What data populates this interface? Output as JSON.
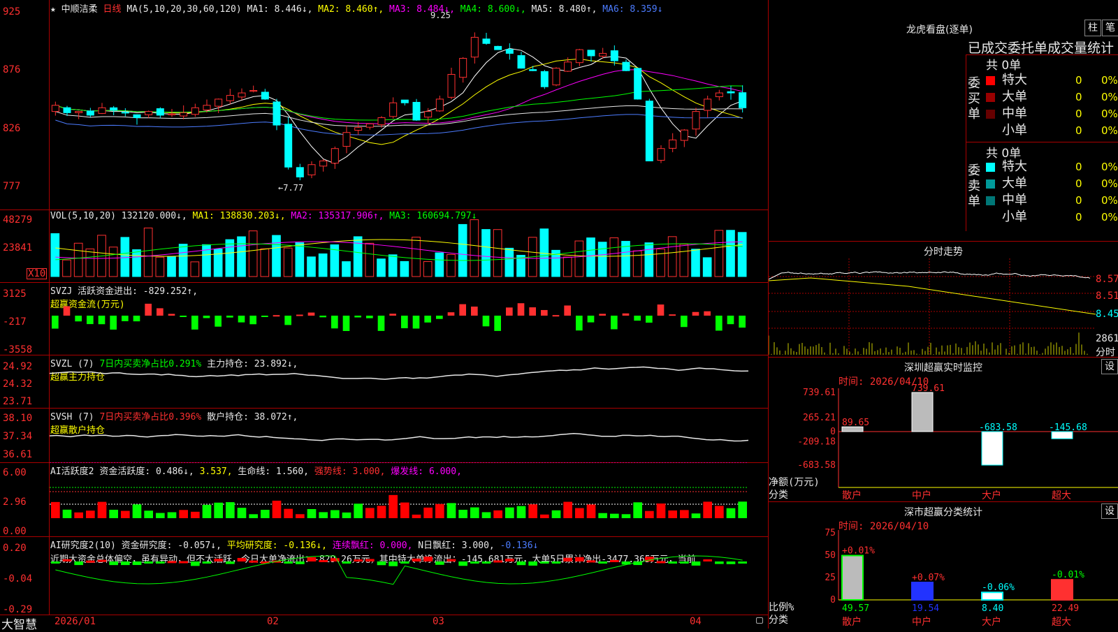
{
  "main": {
    "title_star": "★",
    "stock_name": "中顺洁柔",
    "period": "日线",
    "ma_label": "MA(5,10,20,30,60,120)",
    "ma1": "MA1: 8.446↓,",
    "ma2": "MA2: 8.460↑,",
    "ma3": "MA3: 8.484↓,",
    "ma4": "MA4: 8.600↓,",
    "ma5": "MA5: 8.480↑,",
    "ma6": "MA6: 8.359↓",
    "high_mark": "9.25",
    "low_mark": "←7.77",
    "yticks": [
      "925",
      "876",
      "826",
      "777"
    ]
  },
  "volume": {
    "label": "VOL(5,10,20)",
    "value": "132120.000↓,",
    "ma1": "MA1: 138830.203↓,",
    "ma2": "MA2: 135317.906↑,",
    "ma3": "MA3: 160694.797↓",
    "yticks": [
      "48279",
      "23841"
    ],
    "unit": "X10"
  },
  "svzj": {
    "label": "SVZJ",
    "text": "活跃资金进出: -829.252↑,",
    "sub": "超赢资金流(万元)",
    "yticks": [
      "3125",
      "-217",
      "-3558"
    ]
  },
  "svzl": {
    "label": "SVZL (7)",
    "ratio": "7日内买卖净占比0.291%",
    "hold": "主力持仓: 23.892↓,",
    "sub": "超赢主力持仓",
    "yticks": [
      "24.92",
      "24.32",
      "23.71"
    ]
  },
  "svsh": {
    "label": "SVSH (7)",
    "ratio": "7日内买卖净占比0.396%",
    "hold": "散户持仓: 38.072↑,",
    "sub": "超赢散户持仓",
    "yticks": [
      "38.10",
      "37.34",
      "36.61"
    ]
  },
  "ai1": {
    "label": "AI活跃度2",
    "t1": "资金活跃度: 0.486↓,",
    "t2": "3.537,",
    "t3": "生命线: 1.560,",
    "t4": "强势线: 3.000,",
    "t5": "爆发线: 6.000,",
    "yticks": [
      "6.00",
      "2.96",
      "0.00"
    ]
  },
  "ai2": {
    "label": "AI研究度2(10)",
    "t1": "资金研究度: -0.057↓,",
    "t2": "平均研究度: -0.136↓,",
    "t3": "连续飘红: 0.000,",
    "t4": "N日飘红: 3.000,",
    "t5": "-0.136↓",
    "summary": "近期大资金总体偏空，虽有异动，但不太活跃，今日大单净流出：-829.26万元，其中特大单净流出：-145.681万元，大单5日累计净出-3477.365万元，当前",
    "yticks": [
      "0.20",
      "-0.04",
      "-0.29"
    ]
  },
  "footer": {
    "brand": "大智慧",
    "dates": [
      "2026/01",
      "02",
      "03",
      "04"
    ]
  },
  "dragon": {
    "title": "龙虎看盘(逐单)",
    "btn1": "柱",
    "btn2": "笔",
    "subtitle": "已成交委托单成交量统计",
    "buy_side": "委买单",
    "sell_side": "委卖单",
    "buy_total": "共 0单",
    "sell_total": "共 0单",
    "buy_rows": [
      {
        "name": "特大",
        "count": "0",
        "pct": "0%",
        "color": "#ff0000"
      },
      {
        "name": "大单",
        "count": "0",
        "pct": "0%",
        "color": "#990000"
      },
      {
        "name": "中单",
        "count": "0",
        "pct": "0%",
        "color": "#660000"
      },
      {
        "name": "小单",
        "count": "0",
        "pct": "0%",
        "color": ""
      }
    ],
    "sell_rows": [
      {
        "name": "特大",
        "count": "0",
        "pct": "0%",
        "color": "#00ffff"
      },
      {
        "name": "大单",
        "count": "0",
        "pct": "0%",
        "color": "#009999"
      },
      {
        "name": "中单",
        "count": "0",
        "pct": "0%",
        "color": "#007777"
      },
      {
        "name": "小单",
        "count": "0",
        "pct": "0%",
        "color": ""
      }
    ]
  },
  "intraday": {
    "title": "分时走势",
    "yticks": [
      "8.57",
      "8.51",
      "8.45",
      "2861"
    ],
    "unit": "分时"
  },
  "monitor": {
    "title": "深圳超赢实时监控",
    "btn": "设",
    "time": "时间: 2026/04/10",
    "yticks": [
      "739.61",
      "265.21",
      "0",
      "-209.18",
      "-683.58"
    ],
    "ylabel_1": "净额(万元)",
    "ylabel_2": "分类",
    "categories": [
      "散户",
      "中户",
      "大户",
      "超大"
    ],
    "values": [
      89.65,
      739.61,
      -683.58,
      -145.68
    ],
    "value_labels": [
      "89.65",
      "739.61",
      "-683.58",
      "-145.68"
    ]
  },
  "classify": {
    "title": "深市超赢分类统计",
    "btn": "设",
    "time": "时间: 2026/04/10",
    "yticks": [
      "75",
      "50",
      "25",
      "0"
    ],
    "ylabel_1": "比例%",
    "ylabel_2": "分类",
    "categories": [
      "散户",
      "中户",
      "大户",
      "超大"
    ],
    "values": [
      49.57,
      19.54,
      8.4,
      22.49
    ],
    "value_labels": [
      "49.57",
      "19.54",
      "8.40",
      "22.49"
    ],
    "change_labels": [
      "+0.01%",
      "+0.07%",
      "-0.06%",
      "-0.01%"
    ]
  }
}
